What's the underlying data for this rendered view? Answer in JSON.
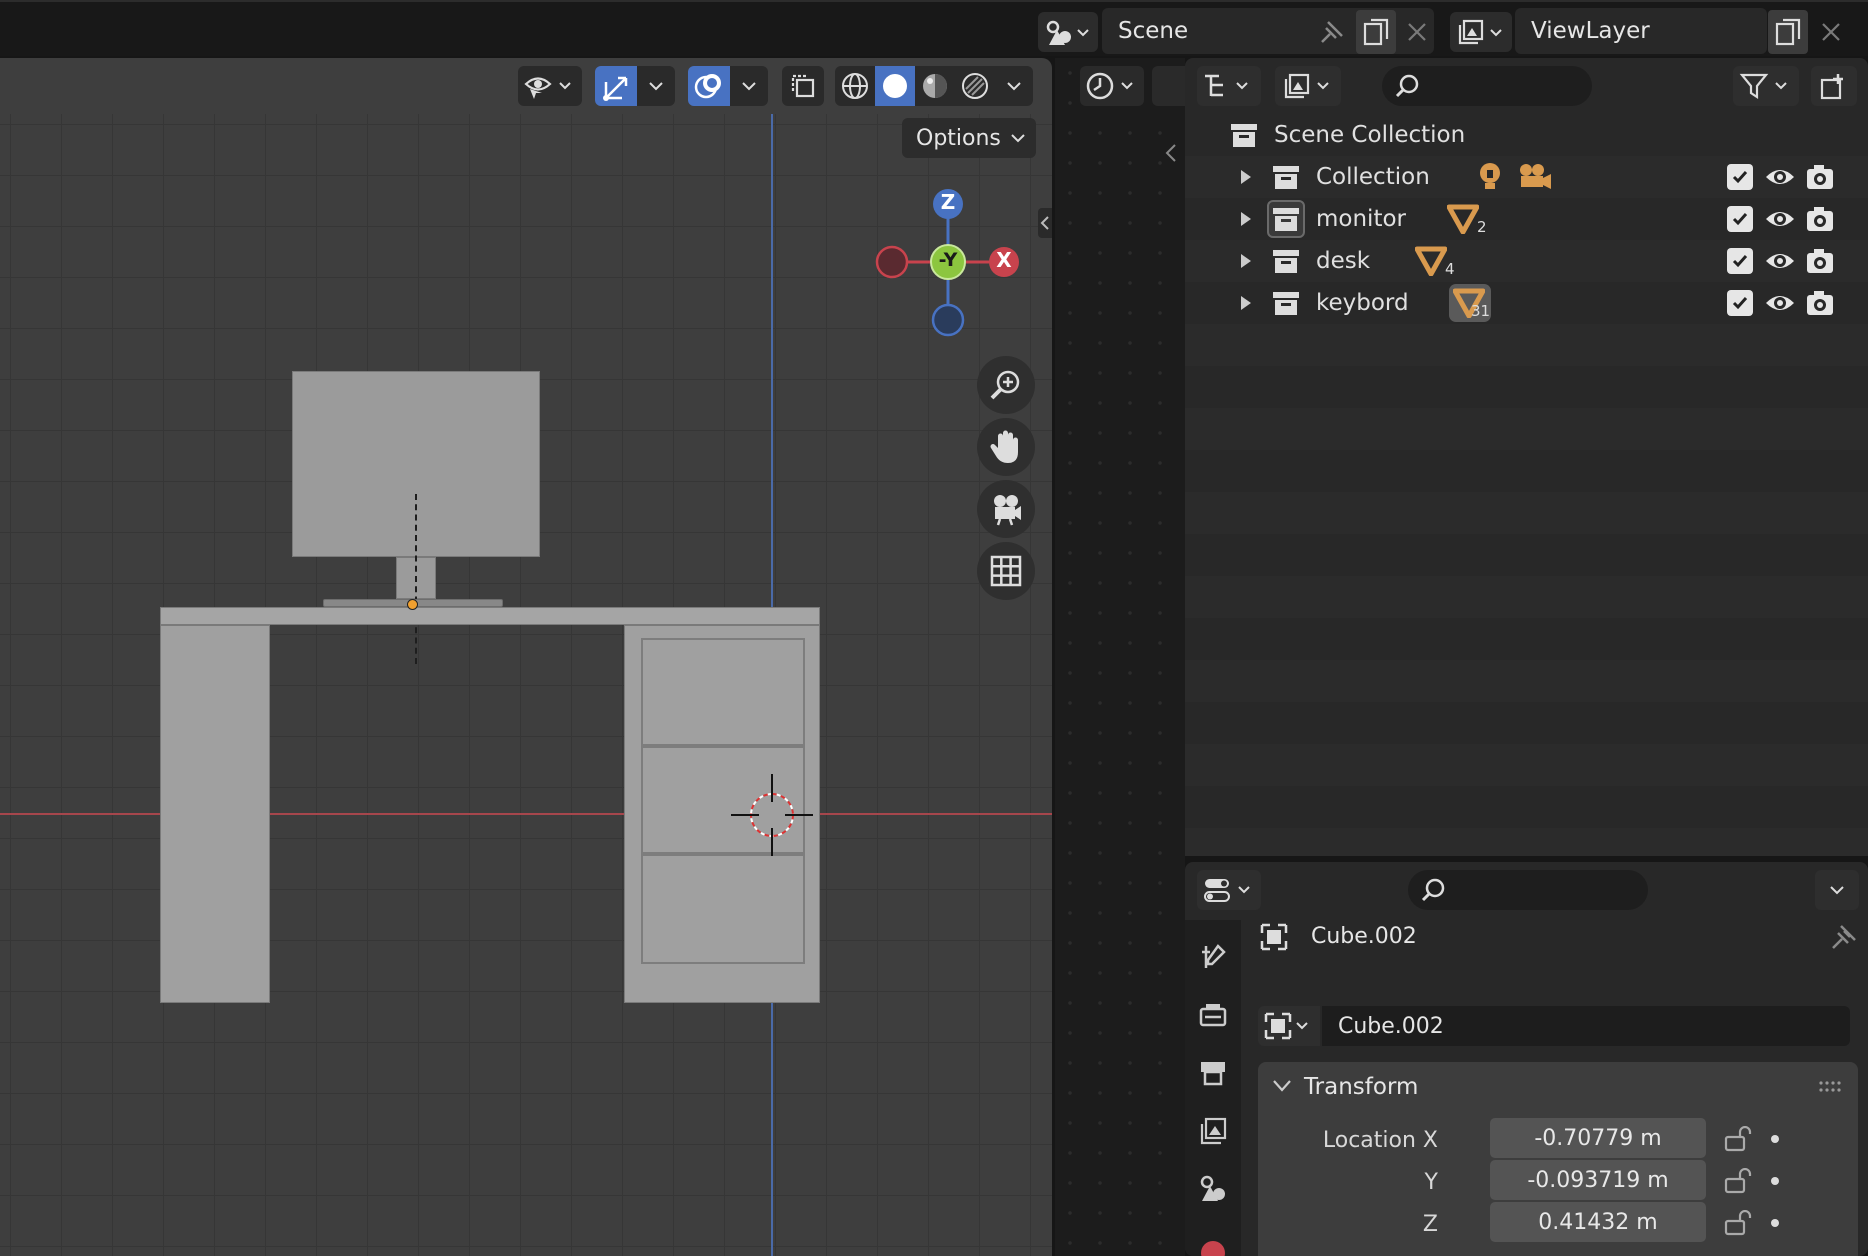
{
  "topbar": {
    "scene_label": "Scene",
    "viewlayer_label": "ViewLayer"
  },
  "viewport": {
    "options_label": "Options",
    "gizmo": {
      "z": "Z",
      "x": "X",
      "neg_y": "-Y"
    },
    "accent_blue": "#4872c2",
    "axis_red": "#c8434d",
    "axis_green": "#8cc63f"
  },
  "outliner": {
    "root_label": "Scene Collection",
    "rows": [
      {
        "label": "Collection",
        "badge": ""
      },
      {
        "label": "monitor",
        "badge": "2"
      },
      {
        "label": "desk",
        "badge": "4"
      },
      {
        "label": "keybord",
        "badge": "31"
      }
    ]
  },
  "properties": {
    "object_name": "Cube.002",
    "data_name": "Cube.002",
    "panel_title": "Transform",
    "location": [
      {
        "label": "Location X",
        "value": "-0.70779 m"
      },
      {
        "label": "Y",
        "value": "-0.093719 m"
      },
      {
        "label": "Z",
        "value": "0.41432 m"
      }
    ]
  }
}
